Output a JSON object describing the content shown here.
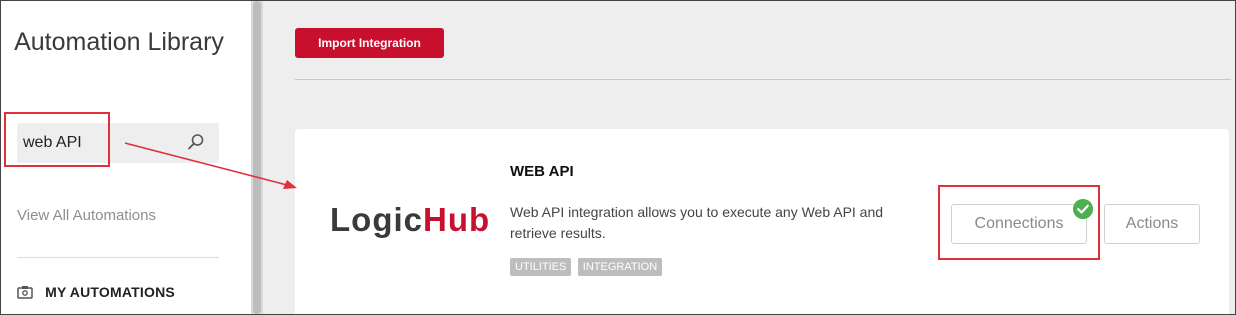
{
  "sidebar": {
    "title": "Automation Library",
    "search": {
      "value": "web API"
    },
    "view_all": "View All Automations",
    "section": "MY AUTOMATIONS"
  },
  "toolbar": {
    "import_label": "Import Integration"
  },
  "card": {
    "logo": {
      "part1": "Logic",
      "part2": "Hub"
    },
    "title": "WEB API",
    "description": "Web API integration allows you to execute any Web API and retrieve results.",
    "tags": [
      "UTILITIES",
      "INTEGRATION"
    ],
    "connections_label": "Connections",
    "actions_label": "Actions",
    "status_icon": "check-circle-icon"
  },
  "colors": {
    "accent": "#c8102e",
    "annotation": "#e0303a",
    "success": "#4caf50"
  }
}
